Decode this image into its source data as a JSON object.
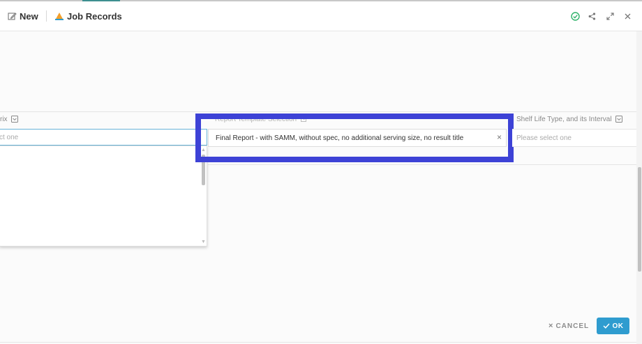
{
  "header": {
    "new_label": "New",
    "title": "Job Records"
  },
  "fields": {
    "left": {
      "label": "rix",
      "placeholder": "ct one"
    },
    "middle": {
      "label": "Report Template Selection",
      "value": "Final Report - with SAMM, without spec, no additional serving size, no result title",
      "clear_symbol": "×"
    },
    "right": {
      "label": "Shelf Life Type, and its Interval",
      "placeholder": "Please select one"
    }
  },
  "footer": {
    "cancel_symbol": "×",
    "cancel_label": "CANCEL",
    "ok_label": "OK"
  },
  "colors": {
    "highlight": "#3d42d6",
    "ok_button": "#2f9ccf",
    "focus_border": "#67b3d8",
    "status_ok": "#2fb36a",
    "title_icon": "#f29f2c"
  },
  "icons": [
    "edit-icon",
    "job-records-icon",
    "check-circle-icon",
    "share-icon",
    "expand-icon",
    "close-icon",
    "dropdown-toggle-icon",
    "check-icon"
  ]
}
